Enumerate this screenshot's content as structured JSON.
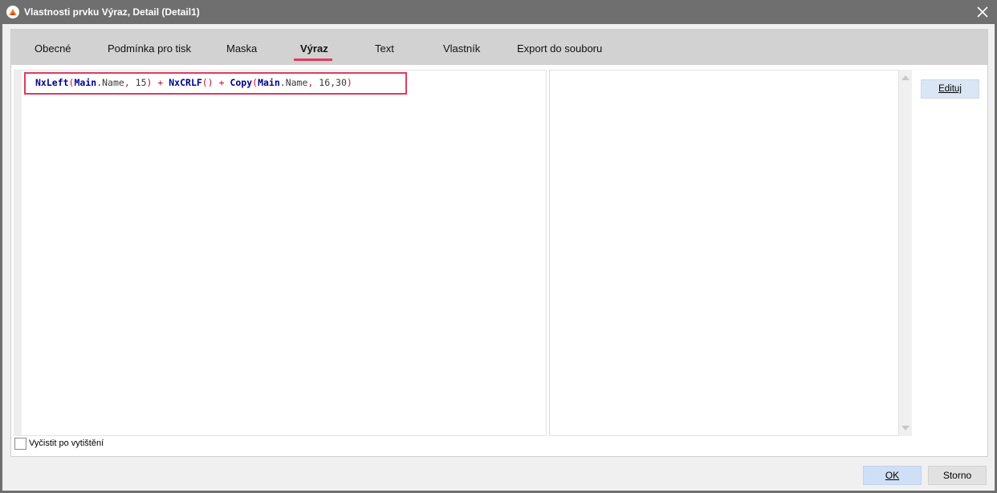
{
  "window": {
    "title": "Vlastnosti prvku Výraz, Detail (Detail1)",
    "close_icon": "close-icon",
    "app_icon": "app-logo-icon"
  },
  "tabs": [
    {
      "label": "Obecné",
      "active": false
    },
    {
      "label": "Podmínka pro tisk",
      "active": false
    },
    {
      "label": "Maska",
      "active": false
    },
    {
      "label": "Výraz",
      "active": true
    },
    {
      "label": "Text",
      "active": false
    },
    {
      "label": "Vlastník",
      "active": false
    },
    {
      "label": "Export do souboru",
      "active": false
    }
  ],
  "expression": {
    "t1": "NxLeft",
    "t2": "(",
    "t3": "Main",
    "t4": ".Name",
    "t5": ", ",
    "t6": "15",
    "t7": ")",
    "t8": " + ",
    "t9": "NxCRLF",
    "t10": "()",
    "t11": " + ",
    "t12": "Copy",
    "t13": "(",
    "t14": "Main",
    "t15": ".Name",
    "t16": ", ",
    "t17": "16,30",
    "t18": ")"
  },
  "buttons": {
    "edit": "Edituj",
    "ok": "OK",
    "storno": "Storno"
  },
  "options": {
    "clear_after_print_label": "Vyčistit po vytištění",
    "clear_after_print_checked": false
  },
  "colors": {
    "accent": "#e23a5b",
    "function": "#00008b",
    "operator": "#c0102a"
  }
}
